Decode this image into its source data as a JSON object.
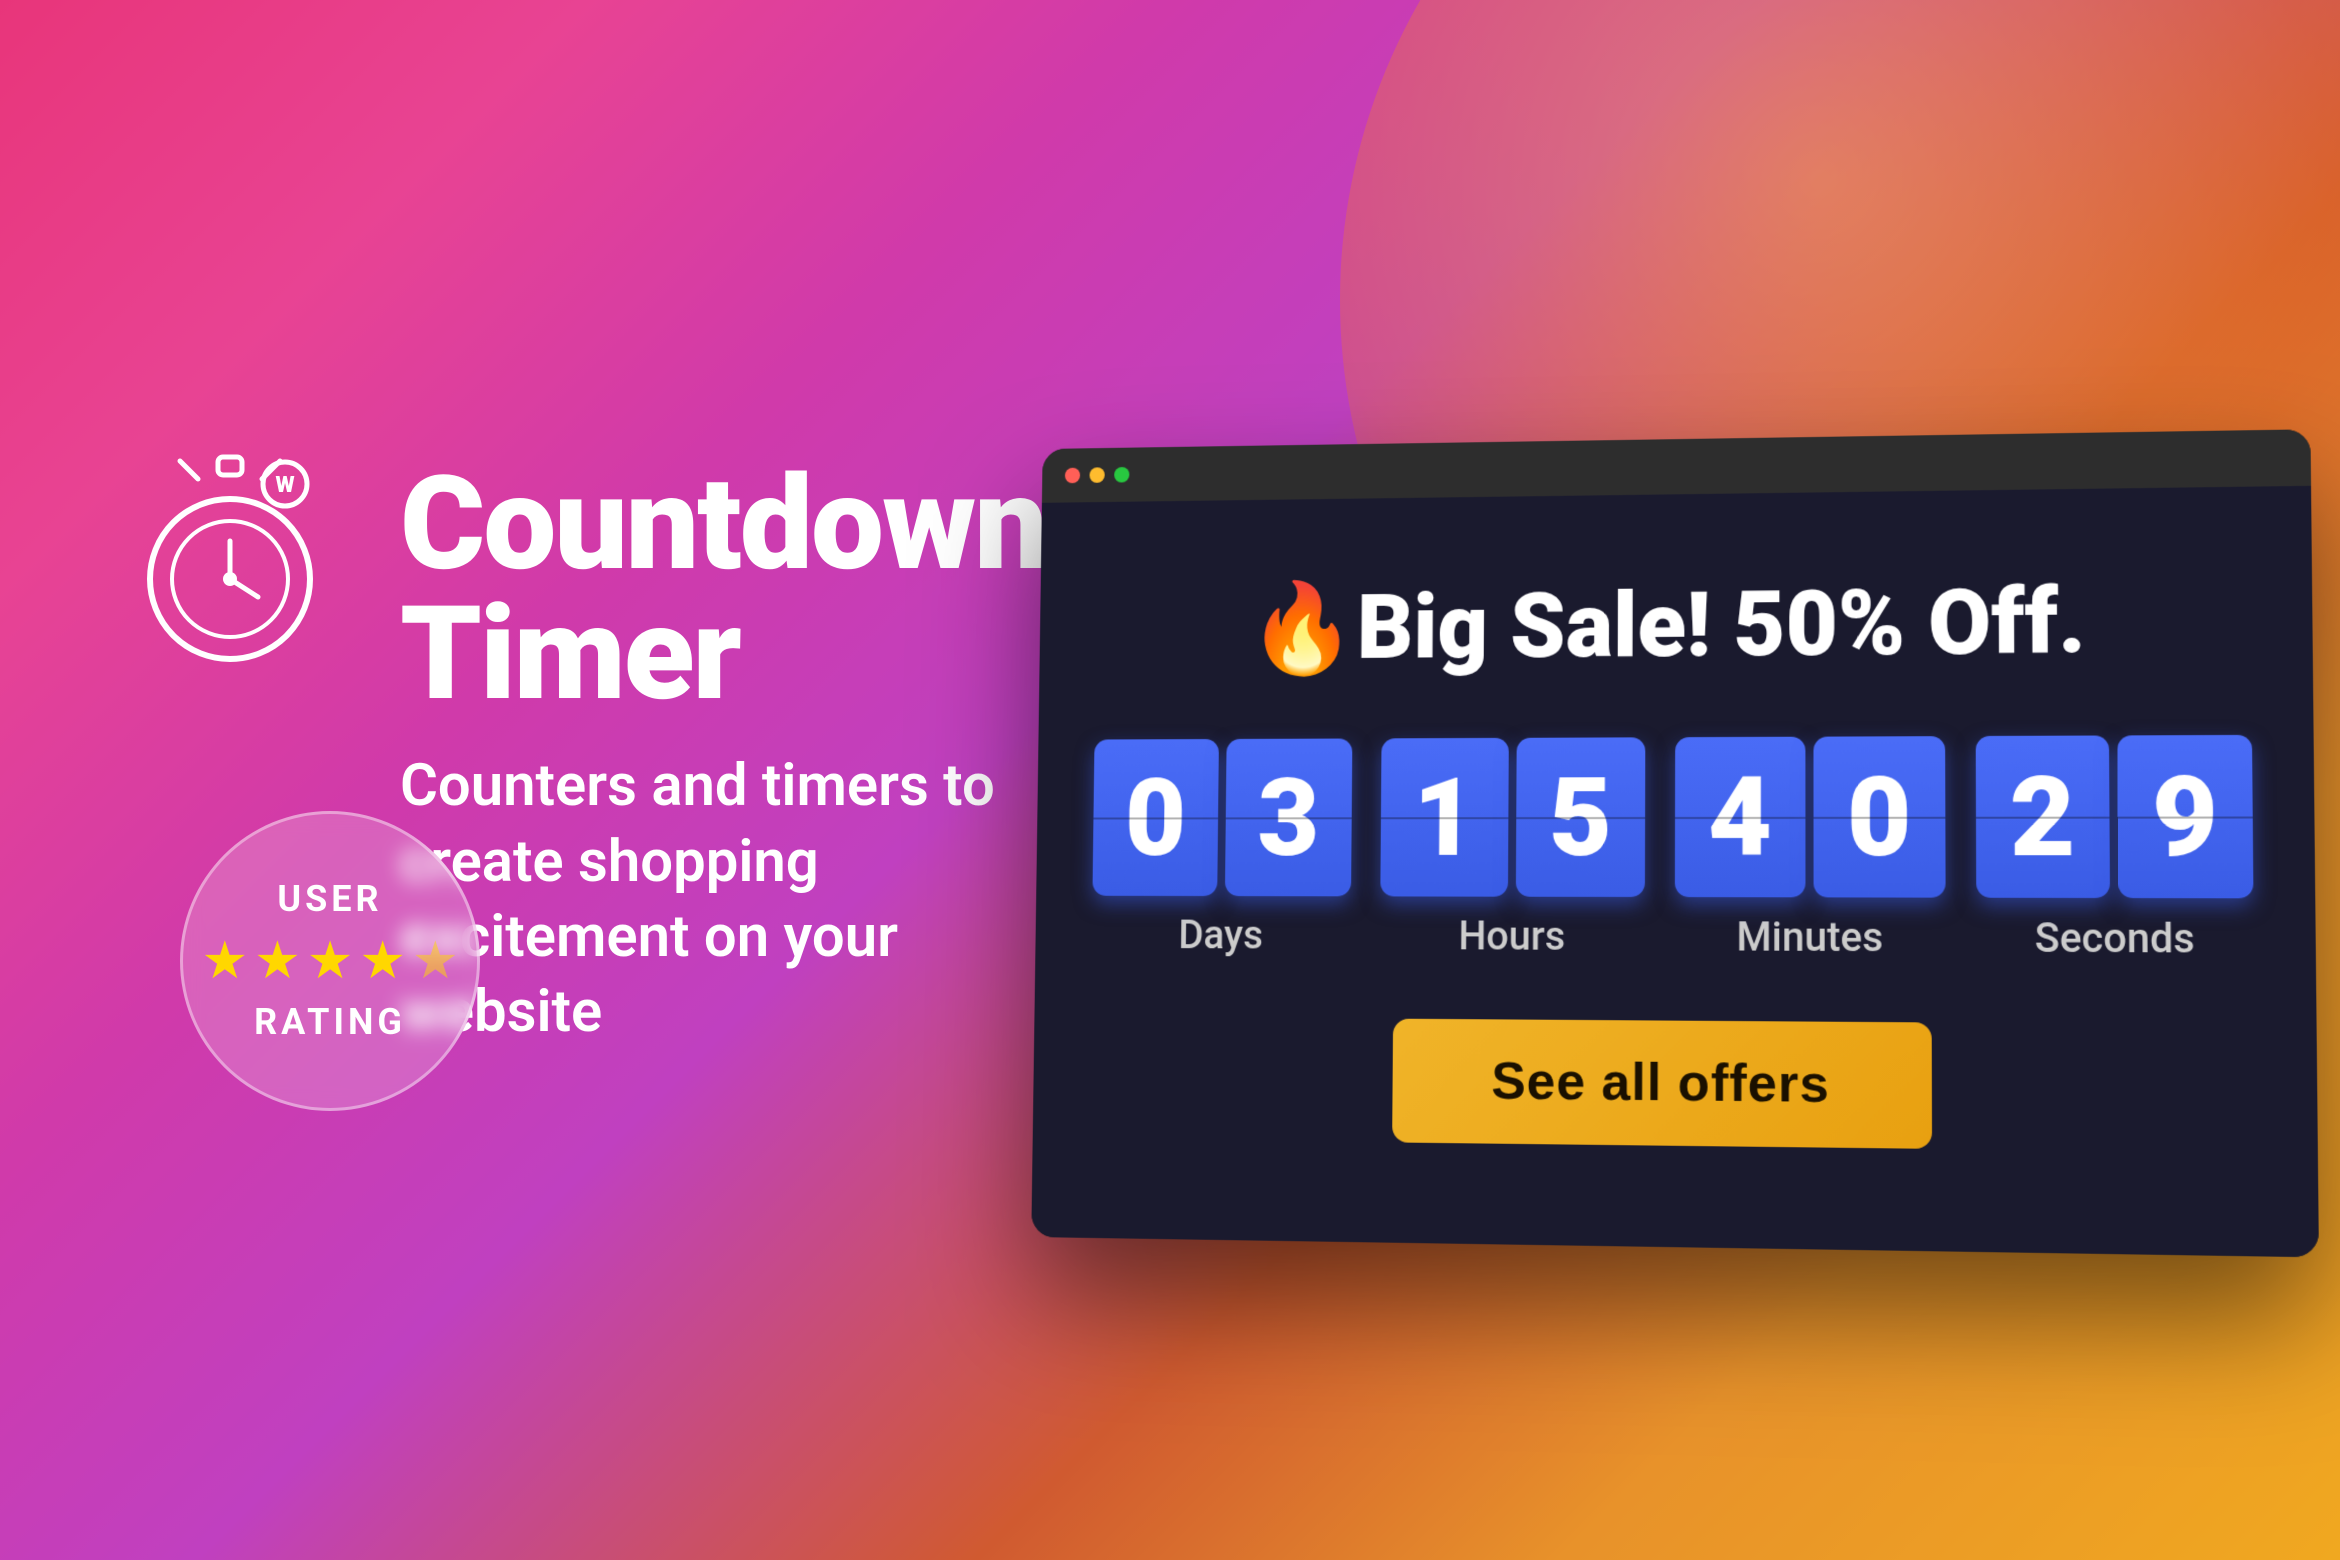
{
  "background": {
    "gradient_description": "pink to orange gradient"
  },
  "header": {
    "title": "Countdown Timer",
    "subtitle": "Counters and timers to create shopping excitement on your website"
  },
  "rating": {
    "label_top": "USER",
    "label_bottom": "RATING",
    "stars": 4,
    "star_symbol": "★"
  },
  "browser_mockup": {
    "dots": [
      "red",
      "yellow",
      "green"
    ],
    "sale_title": "🔥Big Sale! 50% Off.",
    "countdown": {
      "days": {
        "value": "03",
        "label": "Days"
      },
      "hours": {
        "value": "15",
        "label": "Hours"
      },
      "minutes": {
        "value": "40",
        "label": "Minutes"
      },
      "seconds": {
        "value": "29",
        "label": "Seconds"
      }
    },
    "cta_button": "See all offers"
  }
}
